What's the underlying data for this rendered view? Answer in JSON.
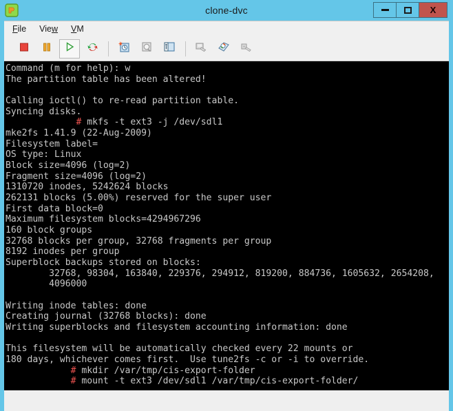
{
  "window": {
    "title": "clone-dvc",
    "icon": "vm-app-icon",
    "accent_titlebar": "#64c6e8",
    "close_button_color": "#c0544c",
    "buttons": [
      {
        "name": "minimize",
        "label": "minimize-icon"
      },
      {
        "name": "maximize",
        "label": "maximize-icon"
      },
      {
        "name": "close",
        "label": "X"
      }
    ]
  },
  "menubar": {
    "items": [
      {
        "name": "file",
        "pre": "F",
        "accel": "",
        "label": "File",
        "a": "F",
        "b": "ile"
      },
      {
        "name": "view",
        "label": "View",
        "a": "Vie",
        "b": "w"
      },
      {
        "name": "vm",
        "label": "VM",
        "a": "V",
        "b": "M"
      }
    ]
  },
  "toolbar": {
    "buttons": [
      {
        "name": "power-off-button",
        "icon": "stop-square-icon",
        "color": "#e8453c"
      },
      {
        "name": "suspend-button",
        "icon": "pause-icon",
        "color": "#f0a830"
      },
      {
        "name": "power-on-button",
        "icon": "play-triangle-icon",
        "color": "#36a03c",
        "framed": true
      },
      {
        "name": "reset-button",
        "icon": "restart-arrows-icon",
        "color": "#d13b2e"
      },
      {
        "name": "snapshot-take-button",
        "icon": "snapshot-new-icon",
        "color": "#5a8fb8"
      },
      {
        "name": "snapshot-revert-button",
        "icon": "snapshot-revert-icon",
        "color": "#9a9a9a"
      },
      {
        "name": "snapshot-manager-button",
        "icon": "snapshot-manager-icon",
        "color": "#5a8fb8"
      },
      {
        "name": "console-button",
        "icon": "console-window-icon",
        "color": "#9a9a9a"
      },
      {
        "name": "settings-button",
        "icon": "vm-settings-icon",
        "color": "#6f9fc4"
      },
      {
        "name": "devices-button",
        "icon": "usb-device-icon",
        "color": "#a0a0a0"
      }
    ]
  },
  "terminal": {
    "background": "#000000",
    "foreground": "#c8c8c8",
    "prompt_color": "#ef5350",
    "lines": [
      {
        "type": "out",
        "text": "Command (m for help): w"
      },
      {
        "type": "out",
        "text": "The partition table has been altered!"
      },
      {
        "type": "out",
        "text": ""
      },
      {
        "type": "out",
        "text": "Calling ioctl() to re-read partition table."
      },
      {
        "type": "out",
        "text": "Syncing disks."
      },
      {
        "type": "cmd",
        "indent": "             ",
        "prompt": "#",
        "text": " mkfs -t ext3 -j /dev/sdl1"
      },
      {
        "type": "out",
        "text": "mke2fs 1.41.9 (22-Aug-2009)"
      },
      {
        "type": "out",
        "text": "Filesystem label="
      },
      {
        "type": "out",
        "text": "OS type: Linux"
      },
      {
        "type": "out",
        "text": "Block size=4096 (log=2)"
      },
      {
        "type": "out",
        "text": "Fragment size=4096 (log=2)"
      },
      {
        "type": "out",
        "text": "1310720 inodes, 5242624 blocks"
      },
      {
        "type": "out",
        "text": "262131 blocks (5.00%) reserved for the super user"
      },
      {
        "type": "out",
        "text": "First data block=0"
      },
      {
        "type": "out",
        "text": "Maximum filesystem blocks=4294967296"
      },
      {
        "type": "out",
        "text": "160 block groups"
      },
      {
        "type": "out",
        "text": "32768 blocks per group, 32768 fragments per group"
      },
      {
        "type": "out",
        "text": "8192 inodes per group"
      },
      {
        "type": "out",
        "text": "Superblock backups stored on blocks:"
      },
      {
        "type": "out",
        "text": "        32768, 98304, 163840, 229376, 294912, 819200, 884736, 1605632, 2654208,"
      },
      {
        "type": "out",
        "text": "        4096000"
      },
      {
        "type": "out",
        "text": ""
      },
      {
        "type": "out",
        "text": "Writing inode tables: done"
      },
      {
        "type": "out",
        "text": "Creating journal (32768 blocks): done"
      },
      {
        "type": "out",
        "text": "Writing superblocks and filesystem accounting information: done"
      },
      {
        "type": "out",
        "text": ""
      },
      {
        "type": "out",
        "text": "This filesystem will be automatically checked every 22 mounts or"
      },
      {
        "type": "out",
        "text": "180 days, whichever comes first.  Use tune2fs -c or -i to override."
      },
      {
        "type": "cmd",
        "indent": "            ",
        "prompt": "#",
        "text": " mkdir /var/tmp/cis-export-folder"
      },
      {
        "type": "cmd",
        "indent": "            ",
        "prompt": "#",
        "text": " mount -t ext3 /dev/sdl1 /var/tmp/cis-export-folder/"
      }
    ]
  },
  "statusbar": {
    "text": ""
  }
}
